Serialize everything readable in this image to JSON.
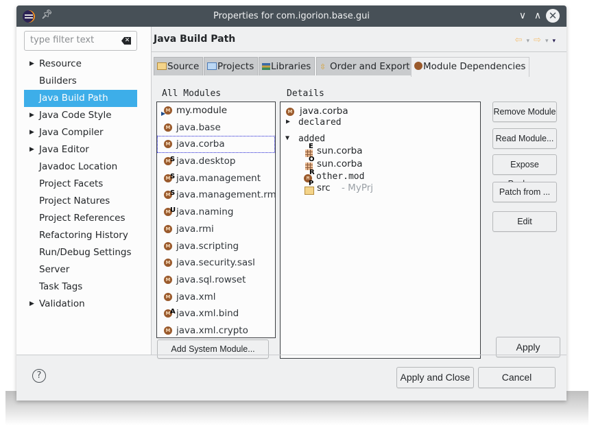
{
  "window": {
    "title": "Properties for com.igorion.base.gui",
    "icons": {
      "app": "eclipse-icon",
      "pin": "pin-icon",
      "minimize": "chevron-down-icon",
      "maximize": "chevron-up-icon",
      "close": "close-icon"
    }
  },
  "sidebar": {
    "filter_placeholder": "type filter text",
    "filter_value": "",
    "items": [
      {
        "label": "Resource",
        "expandable": true
      },
      {
        "label": "Builders",
        "expandable": false
      },
      {
        "label": "Java Build Path",
        "expandable": false,
        "selected": true
      },
      {
        "label": "Java Code Style",
        "expandable": true
      },
      {
        "label": "Java Compiler",
        "expandable": true
      },
      {
        "label": "Java Editor",
        "expandable": true
      },
      {
        "label": "Javadoc Location",
        "expandable": false
      },
      {
        "label": "Project Facets",
        "expandable": false
      },
      {
        "label": "Project Natures",
        "expandable": false
      },
      {
        "label": "Project References",
        "expandable": false
      },
      {
        "label": "Refactoring History",
        "expandable": false
      },
      {
        "label": "Run/Debug Settings",
        "expandable": false
      },
      {
        "label": "Server",
        "expandable": false
      },
      {
        "label": "Task Tags",
        "expandable": false
      },
      {
        "label": "Validation",
        "expandable": true
      }
    ],
    "selection_color": "#3daee9"
  },
  "page": {
    "title": "Java Build Path",
    "history": {
      "back": "⇦",
      "forward": "⇨",
      "dropdown": "▾",
      "menu": "▾"
    }
  },
  "tabs": [
    {
      "label": "Source",
      "icon": "source-folder-icon"
    },
    {
      "label": "Projects",
      "icon": "projects-folder-icon"
    },
    {
      "label": "Libraries",
      "icon": "libraries-icon"
    },
    {
      "label": "Order and Export",
      "icon": "order-export-icon"
    },
    {
      "label": "Module Dependencies",
      "icon": "module-icon",
      "active": true
    }
  ],
  "all_modules": {
    "label": "All Modules",
    "items": [
      {
        "name": "my.module",
        "badge": "",
        "current": true
      },
      {
        "name": "java.base",
        "badge": ""
      },
      {
        "name": "java.corba",
        "badge": "",
        "focused": true
      },
      {
        "name": "java.desktop",
        "badge": "S"
      },
      {
        "name": "java.management",
        "badge": "S"
      },
      {
        "name": "java.management.rmi",
        "badge": "S"
      },
      {
        "name": "java.naming",
        "badge": "U"
      },
      {
        "name": "java.rmi",
        "badge": ""
      },
      {
        "name": "java.scripting",
        "badge": ""
      },
      {
        "name": "java.security.sasl",
        "badge": ""
      },
      {
        "name": "java.sql.rowset",
        "badge": ""
      },
      {
        "name": "java.xml",
        "badge": ""
      },
      {
        "name": "java.xml.bind",
        "badge": "A"
      },
      {
        "name": "java.xml.crypto",
        "badge": ""
      }
    ],
    "add_button": "Add System Module..."
  },
  "details": {
    "label": "Details",
    "module": "java.corba",
    "declared": "declared",
    "added": "added",
    "added_items": [
      {
        "name": "sun.corba",
        "badge": "E",
        "icon": "package-icon"
      },
      {
        "name": "sun.corba",
        "badge": "O",
        "icon": "package-icon"
      },
      {
        "name": "other.mod",
        "badge": "R",
        "icon": "module-icon"
      },
      {
        "name": "src",
        "badge": "P",
        "icon": "source-folder-icon",
        "suffix": "- MyPrj"
      }
    ]
  },
  "actions": {
    "remove_module": "Remove Module",
    "read_module": "Read Module...",
    "expose_package": "Expose Package",
    "patch_from": "Patch from ...",
    "edit": "Edit",
    "apply": "Apply"
  },
  "footer": {
    "help_icon": "?",
    "apply_and_close": "Apply and Close",
    "cancel": "Cancel"
  }
}
